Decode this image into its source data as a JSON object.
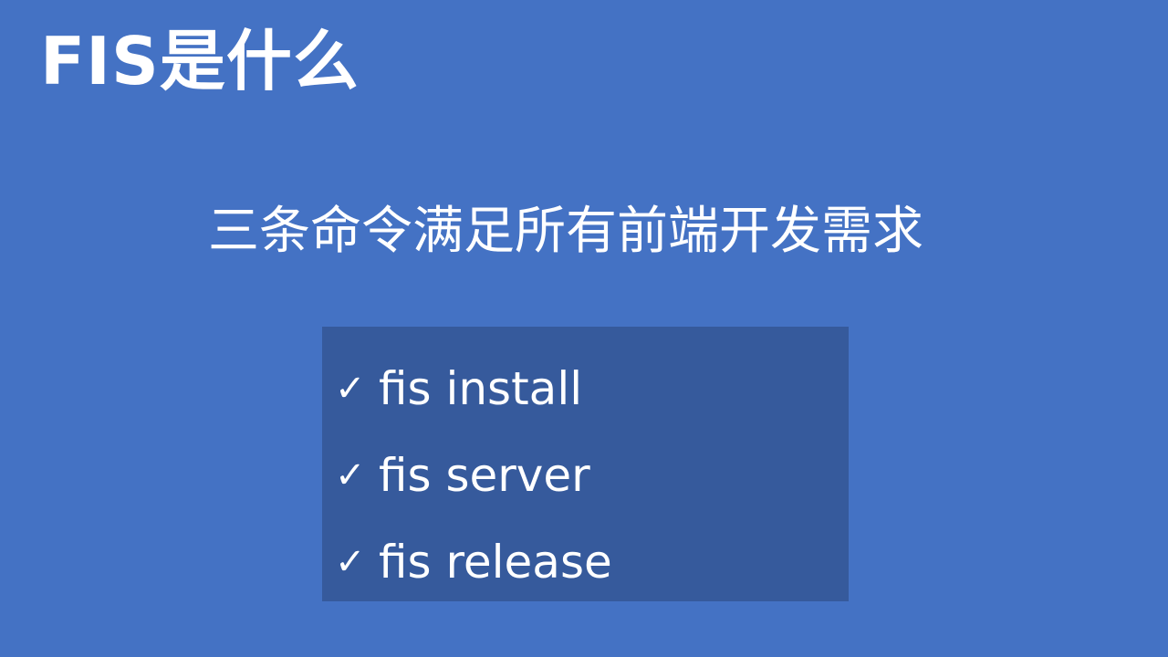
{
  "colors": {
    "background": "#4472c4",
    "box": "#365a9c",
    "text": "#ffffff"
  },
  "title": "FIS是什么",
  "subtitle": "三条命令满足所有前端开发需求",
  "commands": [
    {
      "icon": "check-icon",
      "glyph": "✓",
      "text": "fis install"
    },
    {
      "icon": "check-icon",
      "glyph": "✓",
      "text": "fis server"
    },
    {
      "icon": "check-icon",
      "glyph": "✓",
      "text": "fis release"
    }
  ]
}
